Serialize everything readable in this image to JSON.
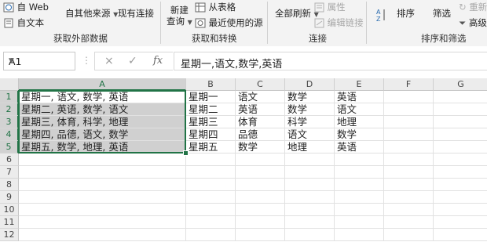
{
  "ribbon": {
    "web": "自 Web",
    "text": "自文本",
    "other_sources": "自其他来源",
    "existing_connections": "现有连接",
    "new_query_line1": "新建",
    "new_query_line2": "查询",
    "from_table": "从表格",
    "recent_sources": "最近使用的源",
    "refresh_all": "全部刷新",
    "properties": "属性",
    "edit_links": "编辑链接",
    "sort": "排序",
    "filter": "筛选",
    "reapply": "重新",
    "advanced": "高级",
    "group_external": "获取外部数据",
    "group_transform": "获取和转换",
    "group_connections": "连接",
    "group_sort_filter": "排序和筛选"
  },
  "formula_bar": {
    "name_box": "A1",
    "cancel_icon": "×",
    "enter_icon": "✓",
    "fx_label": "fx",
    "formula": "星期一,语文,数学,英语"
  },
  "columns": [
    "A",
    "B",
    "C",
    "D",
    "E",
    "F",
    "G"
  ],
  "rows": [
    "1",
    "2",
    "3",
    "4",
    "5",
    "6",
    "7",
    "8",
    "9",
    "10",
    "11",
    "12"
  ],
  "cells": {
    "A": [
      "星期一, 语文, 数学, 英语",
      "星期二, 英语, 数学, 语文",
      "星期三, 体育, 科学, 地理",
      "星期四, 品德, 语文, 数学",
      "星期五, 数学, 地理, 英语"
    ],
    "B": [
      "星期一",
      "星期二",
      "星期三",
      "星期四",
      "星期五"
    ],
    "C": [
      "语文",
      "英语",
      "体育",
      "品德",
      "数学"
    ],
    "D": [
      "数学",
      "数学",
      "科学",
      "语文",
      "地理"
    ],
    "E": [
      "英语",
      "语文",
      "地理",
      "数学",
      "英语"
    ]
  },
  "colors": {
    "accent": "#217346",
    "selection_fill": "#d0d0d0"
  }
}
